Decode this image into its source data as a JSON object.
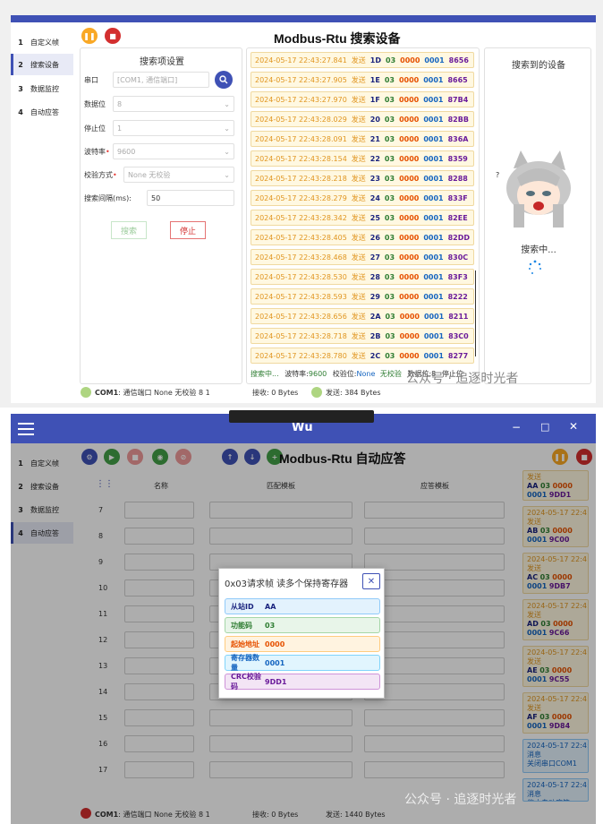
{
  "top": {
    "nav": [
      {
        "num": "1",
        "label": "自定义帧"
      },
      {
        "num": "2",
        "label": "搜索设备"
      },
      {
        "num": "3",
        "label": "数据监控"
      },
      {
        "num": "4",
        "label": "自动应答"
      }
    ],
    "title": "Modbus-Rtu 搜索设备",
    "settings": {
      "heading": "搜索项设置",
      "port_label": "串口",
      "port_value": "[COM1, 通信端口]",
      "databits_label": "数据位",
      "databits_value": "8",
      "stopbits_label": "停止位",
      "stopbits_value": "1",
      "baud_label": "波特率",
      "baud_value": "9600",
      "parity_label": "校验方式",
      "parity_value": "None  无校验",
      "interval_label": "搜索间隔(ms):",
      "interval_value": "50",
      "search_btn": "搜索",
      "stop_btn": "停止"
    },
    "log": [
      {
        "ts": "2024-05-17 22:43:27.841",
        "kind": "发送",
        "addr": "1D",
        "fn": "03",
        "start": "0000",
        "count": "0001",
        "crc": "8656"
      },
      {
        "ts": "2024-05-17 22:43:27.905",
        "kind": "发送",
        "addr": "1E",
        "fn": "03",
        "start": "0000",
        "count": "0001",
        "crc": "8665"
      },
      {
        "ts": "2024-05-17 22:43:27.970",
        "kind": "发送",
        "addr": "1F",
        "fn": "03",
        "start": "0000",
        "count": "0001",
        "crc": "87B4"
      },
      {
        "ts": "2024-05-17 22:43:28.029",
        "kind": "发送",
        "addr": "20",
        "fn": "03",
        "start": "0000",
        "count": "0001",
        "crc": "82BB"
      },
      {
        "ts": "2024-05-17 22:43:28.091",
        "kind": "发送",
        "addr": "21",
        "fn": "03",
        "start": "0000",
        "count": "0001",
        "crc": "836A"
      },
      {
        "ts": "2024-05-17 22:43:28.154",
        "kind": "发送",
        "addr": "22",
        "fn": "03",
        "start": "0000",
        "count": "0001",
        "crc": "8359"
      },
      {
        "ts": "2024-05-17 22:43:28.218",
        "kind": "发送",
        "addr": "23",
        "fn": "03",
        "start": "0000",
        "count": "0001",
        "crc": "8288"
      },
      {
        "ts": "2024-05-17 22:43:28.279",
        "kind": "发送",
        "addr": "24",
        "fn": "03",
        "start": "0000",
        "count": "0001",
        "crc": "833F"
      },
      {
        "ts": "2024-05-17 22:43:28.342",
        "kind": "发送",
        "addr": "25",
        "fn": "03",
        "start": "0000",
        "count": "0001",
        "crc": "82EE"
      },
      {
        "ts": "2024-05-17 22:43:28.405",
        "kind": "发送",
        "addr": "26",
        "fn": "03",
        "start": "0000",
        "count": "0001",
        "crc": "82DD"
      },
      {
        "ts": "2024-05-17 22:43:28.468",
        "kind": "发送",
        "addr": "27",
        "fn": "03",
        "start": "0000",
        "count": "0001",
        "crc": "830C"
      },
      {
        "ts": "2024-05-17 22:43:28.530",
        "kind": "发送",
        "addr": "28",
        "fn": "03",
        "start": "0000",
        "count": "0001",
        "crc": "83F3"
      },
      {
        "ts": "2024-05-17 22:43:28.593",
        "kind": "发送",
        "addr": "29",
        "fn": "03",
        "start": "0000",
        "count": "0001",
        "crc": "8222"
      },
      {
        "ts": "2024-05-17 22:43:28.656",
        "kind": "发送",
        "addr": "2A",
        "fn": "03",
        "start": "0000",
        "count": "0001",
        "crc": "8211"
      },
      {
        "ts": "2024-05-17 22:43:28.718",
        "kind": "发送",
        "addr": "2B",
        "fn": "03",
        "start": "0000",
        "count": "0001",
        "crc": "83C0"
      },
      {
        "ts": "2024-05-17 22:43:28.780",
        "kind": "发送",
        "addr": "2C",
        "fn": "03",
        "start": "0000",
        "count": "0001",
        "crc": "8277"
      }
    ],
    "found_title": "搜索到的设备",
    "searching": "搜索中...",
    "status": {
      "a": "搜索中...",
      "baud_l": "波特率:",
      "baud_v": "9600",
      "parity_l": "校验位:",
      "parity_v": "None",
      "parity_v2": "无校验",
      "databits_l": "数据位:",
      "databits_v": "8",
      "stop_l": "停止位"
    },
    "bottom": {
      "port": "COM1",
      "port_desc": ": 通信端口  None  无校验  8  1",
      "recv": "接收: 0 Bytes",
      "send": "发送: 384 Bytes"
    }
  },
  "bottom_win": {
    "app_title": "Wu",
    "nav": [
      {
        "num": "1",
        "label": "自定义帧"
      },
      {
        "num": "2",
        "label": "搜索设备"
      },
      {
        "num": "3",
        "label": "数据监控"
      },
      {
        "num": "4",
        "label": "自动应答"
      }
    ],
    "title": "Modbus-Rtu 自动应答",
    "cols": {
      "name": "名称",
      "match": "匹配模板",
      "reply": "应答模板"
    },
    "rows": [
      "7",
      "8",
      "9",
      "10",
      "11",
      "12",
      "13",
      "14",
      "15",
      "16",
      "17"
    ],
    "rlog": [
      {
        "l1": "发送",
        "l2a": "AA",
        "l2b": "03",
        "l2c": "0000",
        "l3a": "0001",
        "l3b": "9DD1",
        "c": "o"
      },
      {
        "l0": "2024-05-17 22:4:",
        "l1": "发送",
        "l2a": "AB",
        "l2b": "03",
        "l2c": "0000",
        "l3a": "0001",
        "l3b": "9C00",
        "c": "o"
      },
      {
        "l0": "2024-05-17 22:4:",
        "l1": "发送",
        "l2a": "AC",
        "l2b": "03",
        "l2c": "0000",
        "l3a": "0001",
        "l3b": "9DB7",
        "c": "o"
      },
      {
        "l0": "2024-05-17 22:4:",
        "l1": "发送",
        "l2a": "AD",
        "l2b": "03",
        "l2c": "0000",
        "l3a": "0001",
        "l3b": "9C66",
        "c": "o"
      },
      {
        "l0": "2024-05-17 22:4:",
        "l1": "发送",
        "l2a": "AE",
        "l2b": "03",
        "l2c": "0000",
        "l3a": "0001",
        "l3b": "9C55",
        "c": "o"
      },
      {
        "l0": "2024-05-17 22:4:",
        "l1": "发送",
        "l2a": "AF",
        "l2b": "03",
        "l2c": "0000",
        "l3a": "0001",
        "l3b": "9D84",
        "c": "o"
      }
    ],
    "msg1": {
      "l0": "2024-05-17 22:4:",
      "l1": "消息",
      "l2": "关闭串口COM1"
    },
    "msg2": {
      "l0": "2024-05-17 22:4:",
      "l1": "消息",
      "l2": "停止自动应答"
    },
    "dialog": {
      "title": "0x03请求帧 读多个保持寄存器",
      "fields": [
        {
          "k": "从站ID",
          "v": "AA",
          "bg": "#e3f2fd",
          "bd": "#90caf9",
          "c": "#1a237e"
        },
        {
          "k": "功能码",
          "v": "03",
          "bg": "#e8f5e9",
          "bd": "#a5d6a7",
          "c": "#2e7d32"
        },
        {
          "k": "起始地址",
          "v": "0000",
          "bg": "#fff3e0",
          "bd": "#ffcc80",
          "c": "#e65100"
        },
        {
          "k": "寄存器数量",
          "v": "0001",
          "bg": "#e1f5fe",
          "bd": "#81d4fa",
          "c": "#1565c0"
        },
        {
          "k": "CRC校验码",
          "v": "9DD1",
          "bg": "#f3e5f5",
          "bd": "#ce93d8",
          "c": "#6a1b9a"
        }
      ]
    },
    "status": {
      "port": "COM1",
      "port_desc": ": 通信端口  None  无校验  8  1",
      "recv": "接收: 0 Bytes",
      "send": "发送: 1440 Bytes"
    }
  },
  "watermark": "公众号 · 追逐时光者",
  "colors": {
    "primary": "#3f51b5",
    "warn": "#f9a825",
    "danger": "#d32f2f",
    "green": "#2e7d32"
  }
}
